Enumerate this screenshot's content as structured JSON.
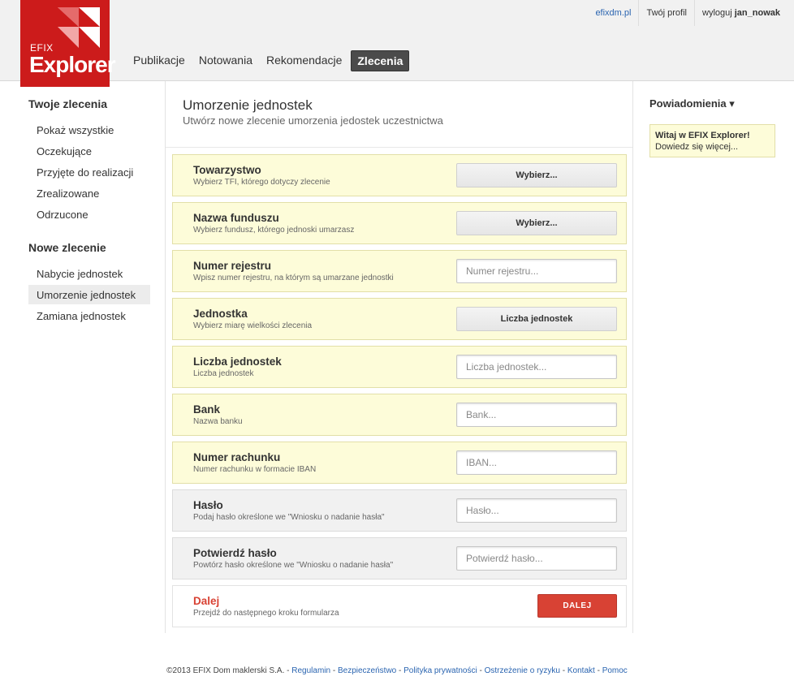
{
  "brand": {
    "small": "EFIX",
    "big": "Explorer"
  },
  "colors": {
    "brand_red": "#cc1b1b",
    "accent_red": "#d84234",
    "link_blue": "#2a64b0",
    "yellow_row": "#fdfcd9"
  },
  "nav": {
    "items": [
      "Publikacje",
      "Notowania",
      "Rekomendacje",
      "Zlecenia"
    ],
    "active": "Zlecenia"
  },
  "toplinks": {
    "site": "efixdm.pl",
    "profile": "Twój profil",
    "logout_prefix": "wyloguj",
    "username": "jan_nowak"
  },
  "sidebar": {
    "group1_title": "Twoje zlecenia",
    "group1_items": [
      "Pokaż wszystkie",
      "Oczekujące",
      "Przyjęte do realizacji",
      "Zrealizowane",
      "Odrzucone"
    ],
    "group2_title": "Nowe zlecenie",
    "group2_items": [
      "Nabycie jednostek",
      "Umorzenie jednostek",
      "Zamiana jednostek"
    ],
    "active": "Umorzenie jednostek"
  },
  "main": {
    "title": "Umorzenie jednostek",
    "subtitle": "Utwórz nowe zlecenie umorzenia jedostek uczestnictwa",
    "rows": [
      {
        "label": "Towarzystwo",
        "hint": "Wybierz TFI, którego dotyczy zlecenie",
        "control": "button",
        "value": "Wybierz...",
        "style": "yellow"
      },
      {
        "label": "Nazwa funduszu",
        "hint": "Wybierz fundusz, którego jednoski umarzasz",
        "control": "button",
        "value": "Wybierz...",
        "style": "yellow"
      },
      {
        "label": "Numer rejestru",
        "hint": "Wpisz numer rejestru, na którym są umarzane jednostki",
        "control": "input",
        "value": "Numer rejestru...",
        "style": "yellow"
      },
      {
        "label": "Jednostka",
        "hint": "Wybierz miarę wielkości zlecenia",
        "control": "button",
        "value": "Liczba jednostek",
        "style": "yellow"
      },
      {
        "label": "Liczba jednostek",
        "hint": "Liczba jednostek",
        "control": "input",
        "value": "Liczba jednostek...",
        "style": "yellow"
      },
      {
        "label": "Bank",
        "hint": "Nazwa banku",
        "control": "input",
        "value": "Bank...",
        "style": "yellow"
      },
      {
        "label": "Numer rachunku",
        "hint": "Numer rachunku w formacie IBAN",
        "control": "input",
        "value": "IBAN...",
        "style": "yellow"
      },
      {
        "label": "Hasło",
        "hint": "Podaj hasło określone we \"Wniosku o nadanie hasła\"",
        "control": "input",
        "value": "Hasło...",
        "style": "gray"
      },
      {
        "label": "Potwierdź hasło",
        "hint": "Powtórz hasło określone we \"Wniosku o nadanie hasła\"",
        "control": "input",
        "value": "Potwierdź hasło...",
        "style": "gray"
      }
    ],
    "next": {
      "label": "Dalej",
      "hint": "Przejdź do następnego kroku formularza",
      "button": "DALEJ"
    }
  },
  "notifications": {
    "title": "Powiadomienia ▾",
    "notice_title": "Witaj w EFIX Explorer!",
    "notice_text": "Dowiedz się więcej..."
  },
  "footer": {
    "copyright": "©2013 EFIX Dom maklerski S.A.",
    "links": [
      "Regulamin",
      "Bezpieczeństwo",
      "Polityka prywatności",
      "Ostrzeżenie o ryzyku",
      "Kontakt",
      "Pomoc"
    ]
  }
}
